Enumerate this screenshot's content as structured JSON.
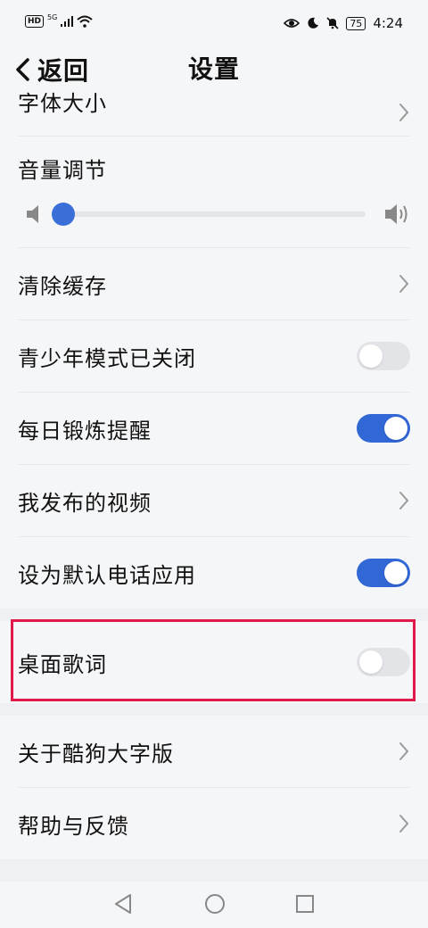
{
  "status": {
    "left_badge": "HD",
    "network": "5G",
    "battery": "75",
    "time": "4:24"
  },
  "header": {
    "back_label": "返回",
    "title": "设置"
  },
  "list": {
    "font_size": "字体大小",
    "volume": {
      "label": "音量调节",
      "level": 0
    },
    "clear_cache": "清除缓存",
    "teen_mode": {
      "label": "青少年模式已关闭",
      "on": false
    },
    "daily_reminder": {
      "label": "每日锻炼提醒",
      "on": true
    },
    "my_videos": "我发布的视频",
    "default_phone": {
      "label": "设为默认电话应用",
      "on": true
    },
    "desktop_lyrics": {
      "label": "桌面歌词",
      "on": false
    },
    "about": "关于酷狗大字版",
    "help": "帮助与反馈"
  },
  "colors": {
    "accent": "#3267d6",
    "highlight_border": "#e0194a"
  }
}
